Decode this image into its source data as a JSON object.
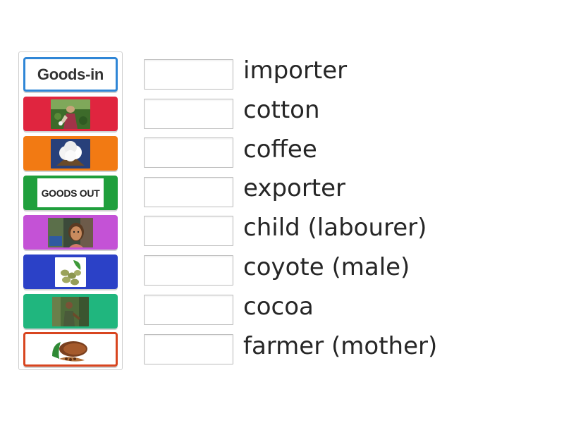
{
  "tiles": {
    "goods_in": "Goods-in",
    "goods_out": "GOODS OUT",
    "images": [
      "cotton-field-worker",
      "cotton-boll",
      "child-portrait",
      "green-coffee-beans",
      "farmer-in-forest",
      "cocoa-pod"
    ]
  },
  "words": [
    "importer",
    "cotton",
    "coffee",
    "exporter",
    "child (labourer)",
    "coyote (male)",
    "cocoa",
    "farmer (mother)"
  ],
  "colors": {
    "tile_red": "#e0253f",
    "tile_orange": "#f27a13",
    "tile_green": "#1f9f3c",
    "tile_purple": "#c452d6",
    "tile_blue": "#2b41c7",
    "tile_teal": "#20b67e",
    "border_blue": "#2f86d6",
    "border_orange": "#d8451f"
  }
}
